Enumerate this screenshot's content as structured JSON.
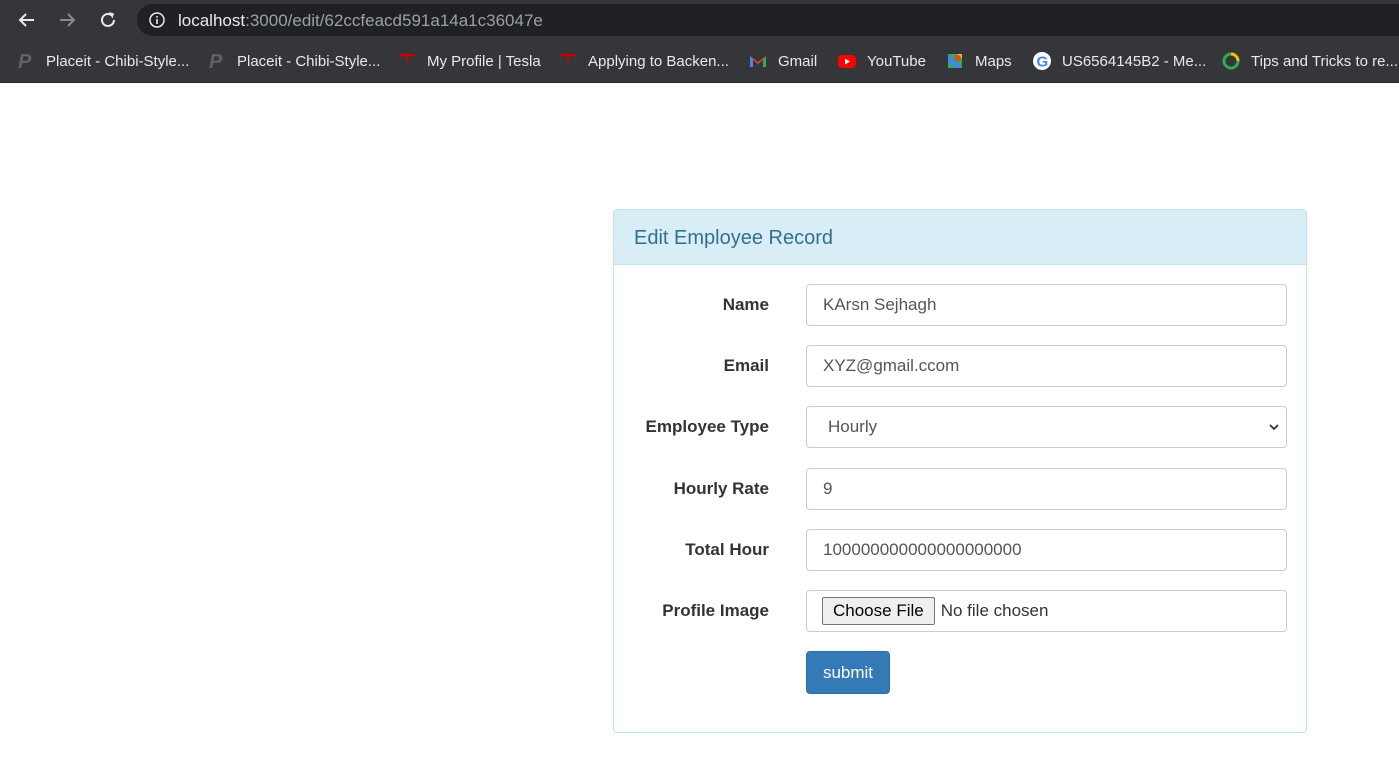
{
  "browser": {
    "url_host": "localhost",
    "url_path": ":3000/edit/62ccfeacd591a14a1c36047e",
    "bookmarks": [
      {
        "label": "Placeit - Chibi-Style...",
        "icon": "placeit-icon"
      },
      {
        "label": "Placeit - Chibi-Style...",
        "icon": "placeit-icon"
      },
      {
        "label": "My Profile | Tesla",
        "icon": "tesla-icon"
      },
      {
        "label": "Applying to Backen...",
        "icon": "tesla-icon"
      },
      {
        "label": "Gmail",
        "icon": "gmail-icon"
      },
      {
        "label": "YouTube",
        "icon": "youtube-icon"
      },
      {
        "label": "Maps",
        "icon": "maps-icon"
      },
      {
        "label": "US6564145B2 - Me...",
        "icon": "google-icon"
      },
      {
        "label": "Tips and Tricks to re...",
        "icon": "ring-icon"
      }
    ]
  },
  "panel": {
    "title": "Edit Employee Record"
  },
  "form": {
    "name_label": "Name",
    "name_value": "KArsn Sejhagh",
    "email_label": "Email",
    "email_value": "XYZ@gmail.ccom",
    "type_label": "Employee Type",
    "type_value": "Hourly",
    "rate_label": "Hourly Rate",
    "rate_value": "9",
    "hour_label": "Total Hour",
    "hour_value": "100000000000000000000",
    "image_label": "Profile Image",
    "choose_file": "Choose File",
    "no_file": "No file chosen",
    "submit": "submit"
  },
  "colors": {
    "panel_heading_bg": "#d9edf7",
    "panel_title": "#31708f",
    "submit_bg": "#337ab7",
    "chrome_bg": "#35363a"
  }
}
